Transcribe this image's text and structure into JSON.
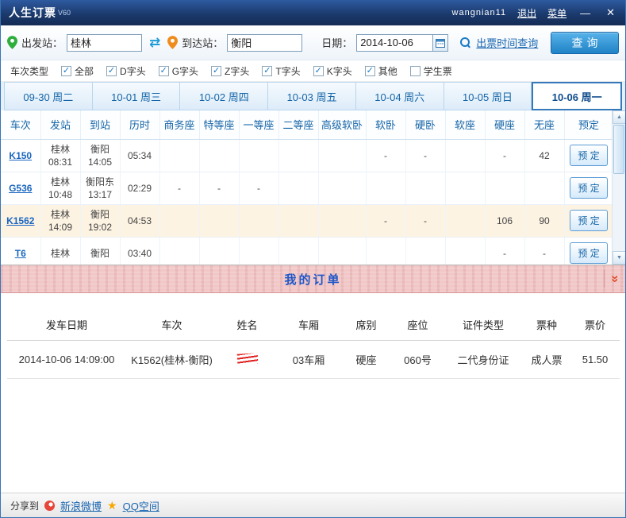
{
  "window": {
    "title": "人生订票",
    "version": "V60",
    "username": "wangnian11",
    "logout_label": "退出",
    "menu_label": "菜单",
    "minimize_glyph": "—",
    "close_glyph": "✕"
  },
  "search": {
    "from_label": "出发站：",
    "from_value": "桂林",
    "to_label": "到达站：",
    "to_value": "衡阳",
    "date_label": "日期：",
    "date_value": "2014-10-06",
    "ticket_time_link": "出票时间查询",
    "query_button": "查询"
  },
  "filters": {
    "label": "车次类型",
    "options": [
      {
        "label": "全部",
        "checked": true
      },
      {
        "label": "D字头",
        "checked": true
      },
      {
        "label": "G字头",
        "checked": true
      },
      {
        "label": "Z字头",
        "checked": true
      },
      {
        "label": "T字头",
        "checked": true
      },
      {
        "label": "K字头",
        "checked": true
      },
      {
        "label": "其他",
        "checked": true
      },
      {
        "label": "学生票",
        "checked": false
      }
    ]
  },
  "date_tabs": [
    {
      "label": "09-30 周二",
      "active": false
    },
    {
      "label": "10-01 周三",
      "active": false
    },
    {
      "label": "10-02 周四",
      "active": false
    },
    {
      "label": "10-03 周五",
      "active": false
    },
    {
      "label": "10-04 周六",
      "active": false
    },
    {
      "label": "10-05 周日",
      "active": false
    },
    {
      "label": "10-06 周一",
      "active": true
    }
  ],
  "train_table": {
    "headers": [
      "车次",
      "发站",
      "到站",
      "历时",
      "商务座",
      "特等座",
      "一等座",
      "二等座",
      "高级软卧",
      "软卧",
      "硬卧",
      "软座",
      "硬座",
      "无座",
      "预定"
    ],
    "book_label": "预 定",
    "rows": [
      {
        "train": "K150",
        "from_station": "桂林",
        "from_time": "08:31",
        "to_station": "衡阳",
        "to_time": "14:05",
        "duration": "05:34",
        "highlight": false,
        "seats": [
          {
            "t": ""
          },
          {
            "t": ""
          },
          {
            "t": ""
          },
          {
            "t": ""
          },
          {
            "t": ""
          },
          {
            "t": "-"
          },
          {
            "t": "-"
          },
          {
            "t": ""
          },
          {
            "t": "-"
          },
          {
            "t": "42",
            "c": "orange"
          }
        ]
      },
      {
        "train": "G536",
        "from_station": "桂林",
        "from_time": "10:48",
        "to_station": "衡阳东",
        "to_time": "13:17",
        "duration": "02:29",
        "highlight": false,
        "seats": [
          {
            "t": "-"
          },
          {
            "t": "-"
          },
          {
            "t": "-"
          },
          {
            "t": ""
          },
          {
            "t": ""
          },
          {
            "t": ""
          },
          {
            "t": ""
          },
          {
            "t": ""
          },
          {
            "t": ""
          },
          {
            "t": ""
          }
        ]
      },
      {
        "train": "K1562",
        "from_station": "桂林",
        "from_time": "14:09",
        "to_station": "衡阳",
        "to_time": "19:02",
        "duration": "04:53",
        "highlight": true,
        "seats": [
          {
            "t": ""
          },
          {
            "t": ""
          },
          {
            "t": ""
          },
          {
            "t": ""
          },
          {
            "t": ""
          },
          {
            "t": "-"
          },
          {
            "t": "-"
          },
          {
            "t": ""
          },
          {
            "t": "106",
            "c": "green"
          },
          {
            "t": "90",
            "c": "green"
          }
        ]
      },
      {
        "train": "T6",
        "from_station": "桂林",
        "from_time": "",
        "to_station": "衡阳",
        "to_time": "",
        "duration": "03:40",
        "highlight": false,
        "seats": [
          {
            "t": ""
          },
          {
            "t": ""
          },
          {
            "t": ""
          },
          {
            "t": ""
          },
          {
            "t": ""
          },
          {
            "t": ""
          },
          {
            "t": ""
          },
          {
            "t": ""
          },
          {
            "t": "-"
          },
          {
            "t": "-"
          }
        ]
      }
    ]
  },
  "orders": {
    "banner_title": "我的订单",
    "headers": [
      "发车日期",
      "车次",
      "姓名",
      "车厢",
      "席别",
      "座位",
      "证件类型",
      "票种",
      "票价"
    ],
    "rows": [
      {
        "depart_datetime": "2014-10-06 14:09:00",
        "train": "K1562(桂林-衡阳)",
        "name_redacted": true,
        "carriage": "03车厢",
        "seat_class": "硬座",
        "seat_no": "060号",
        "id_type": "二代身份证",
        "ticket_type": "成人票",
        "price": "51.50"
      }
    ]
  },
  "share": {
    "label": "分享到",
    "links": [
      {
        "label": "新浪微博",
        "icon": "weibo"
      },
      {
        "label": "QQ空间",
        "icon": "qzone"
      }
    ]
  },
  "icons": {
    "swap": "⇄",
    "check": "✓",
    "star": "★",
    "expand": "»",
    "scroll_up": "▲",
    "scroll_down": "▼"
  },
  "colors": {
    "titlebar": "#1b3a6d",
    "accent": "#1a7ac4",
    "available_green": "#17a82b",
    "few_orange": "#ff7300",
    "banner_pink": "#f1c7c7"
  }
}
